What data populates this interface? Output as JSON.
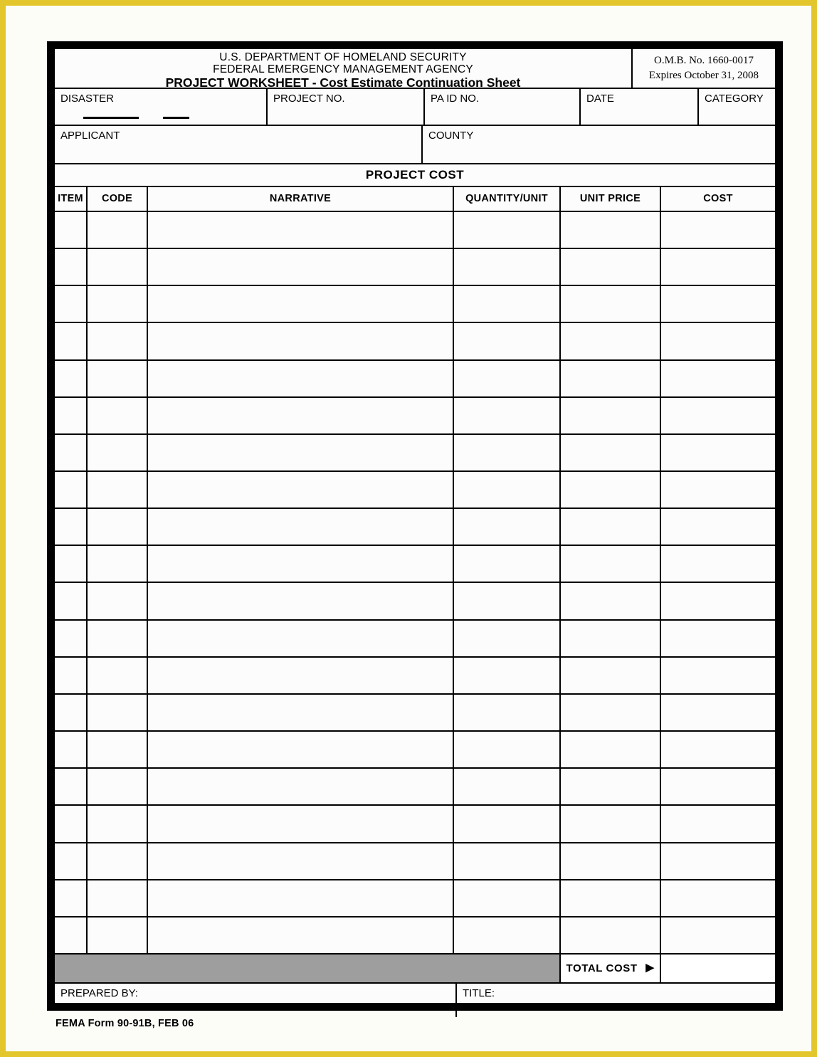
{
  "document": {
    "header": {
      "agency_line_1": "U.S. DEPARTMENT OF HOMELAND SECURITY",
      "agency_line_2": "FEDERAL EMERGENCY MANAGEMENT AGENCY",
      "form_title": "PROJECT WORKSHEET - Cost Estimate Continuation Sheet",
      "omb_number": "O.M.B. No. 1660-0017",
      "omb_expires": "Expires October 31, 2008"
    },
    "identification_fields": {
      "disaster": "DISASTER",
      "project_no": "PROJECT NO.",
      "pa_id_no": "PA ID NO.",
      "date": "DATE",
      "category": "CATEGORY",
      "applicant": "APPLICANT",
      "county": "COUNTY"
    },
    "field_values": {
      "disaster": "",
      "project_no": "",
      "pa_id_no": "",
      "date": "",
      "category": "",
      "applicant": "",
      "county": ""
    },
    "project_cost": {
      "section_title": "PROJECT COST",
      "columns": [
        "ITEM",
        "CODE",
        "NARRATIVE",
        "QUANTITY/UNIT",
        "UNIT PRICE",
        "COST"
      ],
      "row_count": 20,
      "rows": [
        {
          "item": "",
          "code": "",
          "narrative": "",
          "quantity_unit": "",
          "unit_price": "",
          "cost": ""
        },
        {
          "item": "",
          "code": "",
          "narrative": "",
          "quantity_unit": "",
          "unit_price": "",
          "cost": ""
        },
        {
          "item": "",
          "code": "",
          "narrative": "",
          "quantity_unit": "",
          "unit_price": "",
          "cost": ""
        },
        {
          "item": "",
          "code": "",
          "narrative": "",
          "quantity_unit": "",
          "unit_price": "",
          "cost": ""
        },
        {
          "item": "",
          "code": "",
          "narrative": "",
          "quantity_unit": "",
          "unit_price": "",
          "cost": ""
        },
        {
          "item": "",
          "code": "",
          "narrative": "",
          "quantity_unit": "",
          "unit_price": "",
          "cost": ""
        },
        {
          "item": "",
          "code": "",
          "narrative": "",
          "quantity_unit": "",
          "unit_price": "",
          "cost": ""
        },
        {
          "item": "",
          "code": "",
          "narrative": "",
          "quantity_unit": "",
          "unit_price": "",
          "cost": ""
        },
        {
          "item": "",
          "code": "",
          "narrative": "",
          "quantity_unit": "",
          "unit_price": "",
          "cost": ""
        },
        {
          "item": "",
          "code": "",
          "narrative": "",
          "quantity_unit": "",
          "unit_price": "",
          "cost": ""
        },
        {
          "item": "",
          "code": "",
          "narrative": "",
          "quantity_unit": "",
          "unit_price": "",
          "cost": ""
        },
        {
          "item": "",
          "code": "",
          "narrative": "",
          "quantity_unit": "",
          "unit_price": "",
          "cost": ""
        },
        {
          "item": "",
          "code": "",
          "narrative": "",
          "quantity_unit": "",
          "unit_price": "",
          "cost": ""
        },
        {
          "item": "",
          "code": "",
          "narrative": "",
          "quantity_unit": "",
          "unit_price": "",
          "cost": ""
        },
        {
          "item": "",
          "code": "",
          "narrative": "",
          "quantity_unit": "",
          "unit_price": "",
          "cost": ""
        },
        {
          "item": "",
          "code": "",
          "narrative": "",
          "quantity_unit": "",
          "unit_price": "",
          "cost": ""
        },
        {
          "item": "",
          "code": "",
          "narrative": "",
          "quantity_unit": "",
          "unit_price": "",
          "cost": ""
        },
        {
          "item": "",
          "code": "",
          "narrative": "",
          "quantity_unit": "",
          "unit_price": "",
          "cost": ""
        },
        {
          "item": "",
          "code": "",
          "narrative": "",
          "quantity_unit": "",
          "unit_price": "",
          "cost": ""
        },
        {
          "item": "",
          "code": "",
          "narrative": "",
          "quantity_unit": "",
          "unit_price": "",
          "cost": ""
        }
      ],
      "total_cost_label": "TOTAL COST",
      "total_cost_arrow": "▶",
      "total_cost_value": ""
    },
    "signature_block": {
      "prepared_by": "PREPARED BY:",
      "prepared_by_value": "",
      "title": "TITLE:",
      "title_value": ""
    },
    "footer": {
      "form_number": "FEMA Form 90-91B, FEB 06"
    },
    "colors": {
      "frame": "#000000",
      "total_row_fill": "#9e9e9e",
      "page_edge": "#e3c62c",
      "paper": "#fcfcfc"
    }
  }
}
